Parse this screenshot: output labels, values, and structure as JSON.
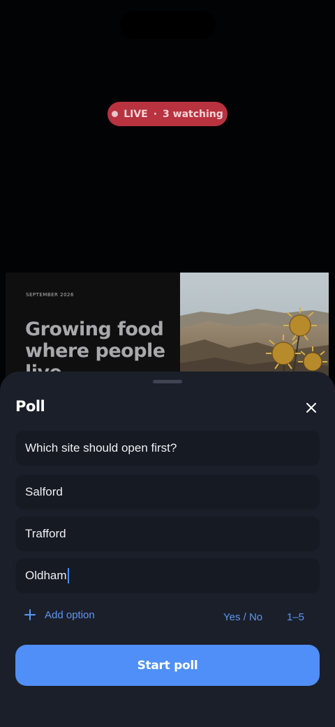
{
  "live": {
    "status": "LIVE",
    "separator": "·",
    "watching": "3 watching",
    "color": "#b8323f"
  },
  "slide": {
    "date": "SEPTEMBER 2026",
    "title": "Growing food where people live"
  },
  "poll": {
    "title": "Poll",
    "question": "Which site should open first?",
    "options": [
      "Salford",
      "Trafford",
      "Oldham"
    ],
    "add_option_label": "Add option",
    "type_yes_no": "Yes / No",
    "type_scale": "1–5",
    "start_label": "Start poll",
    "accent": "#4f8ff7"
  }
}
